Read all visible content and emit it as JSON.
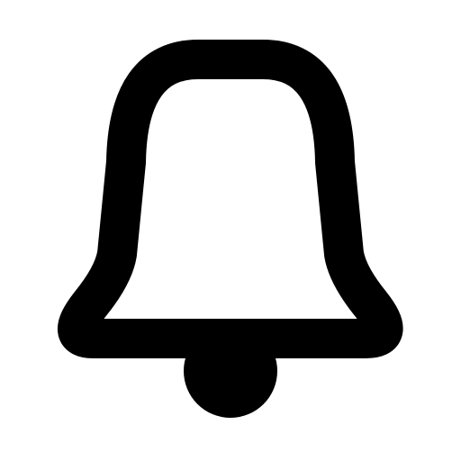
{
  "icon": {
    "name": "bell-icon",
    "color": "#000000",
    "background": "#ffffff"
  }
}
